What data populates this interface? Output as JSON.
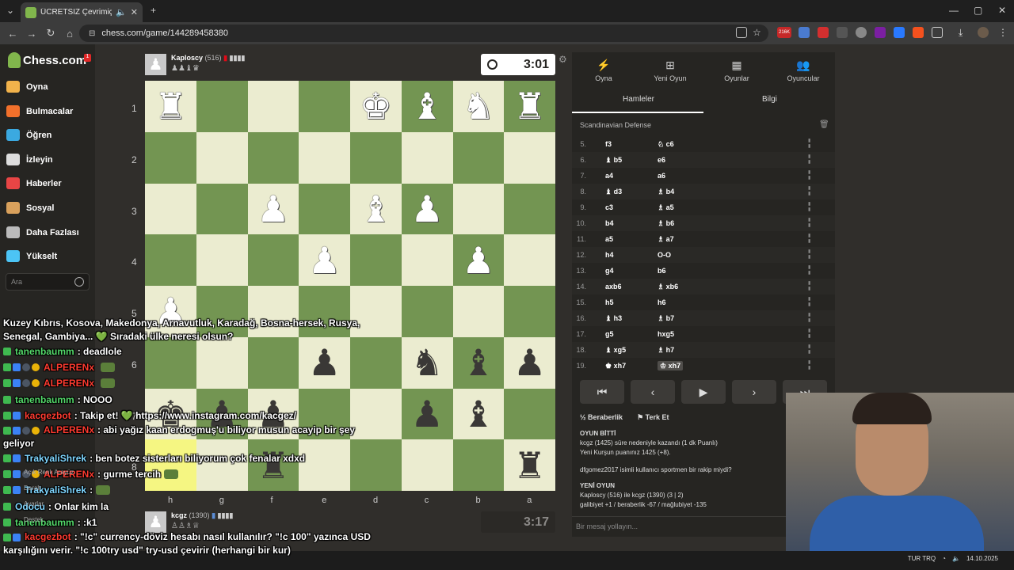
{
  "browser": {
    "tab_title": "ÜCRETSİZ Çevrimiçi Satranç",
    "url": "chess.com/game/144289458380",
    "ext_badge": "216K"
  },
  "sidebar": {
    "logo": "Chess.com",
    "notif_count": "1",
    "items": [
      {
        "label": "Oyna",
        "icon": "pawn-play-icon",
        "color": "#f2b34b"
      },
      {
        "label": "Bulmacalar",
        "icon": "puzzle-icon",
        "color": "#f2702b"
      },
      {
        "label": "Öğren",
        "icon": "learn-icon",
        "color": "#3ba9e0"
      },
      {
        "label": "İzleyin",
        "icon": "binoculars-icon",
        "color": "#dddddd"
      },
      {
        "label": "Haberler",
        "icon": "news-icon",
        "color": "#e84545"
      },
      {
        "label": "Sosyal",
        "icon": "social-icon",
        "color": "#d9a15c"
      },
      {
        "label": "Daha Fazlası",
        "icon": "more-icon",
        "color": "#bbbbbb"
      },
      {
        "label": "Yükselt",
        "icon": "diamond-icon",
        "color": "#4cc4f5"
      }
    ],
    "search_placeholder": "Ara"
  },
  "game": {
    "top_player": {
      "name": "Kaploscy",
      "rating": "(516)",
      "clock": "3:01"
    },
    "bottom_player": {
      "name": "kcgz",
      "rating": "(1390)",
      "clock": "3:17"
    },
    "ranks": [
      "1",
      "2",
      "3",
      "4",
      "5",
      "6",
      "7",
      "8"
    ],
    "files": [
      "h",
      "g",
      "f",
      "e",
      "d",
      "c",
      "b",
      "a"
    ],
    "board": [
      [
        "wR",
        "",
        "",
        "",
        "wK",
        "wB",
        "wN",
        "wR"
      ],
      [
        "",
        "",
        "",
        "",
        "",
        "",
        "",
        ""
      ],
      [
        "",
        "",
        "wP",
        "",
        "wB",
        "wP",
        "",
        ""
      ],
      [
        "",
        "",
        "",
        "wP",
        "",
        "",
        "wP",
        ""
      ],
      [
        "wP",
        "",
        "",
        "",
        "",
        "",
        "",
        ""
      ],
      [
        "",
        "",
        "",
        "bP",
        "",
        "bN",
        "bB",
        "bP"
      ],
      [
        "bK",
        "bP",
        "bP",
        "",
        "",
        "bP",
        "bB",
        ""
      ],
      [
        "",
        "",
        "bR",
        "",
        "",
        "",
        "",
        "bR"
      ]
    ],
    "highlights": [
      "7-0",
      "8-1"
    ]
  },
  "panel": {
    "tabs": [
      "Oyna",
      "Yeni Oyun",
      "Oyunlar",
      "Oyuncular"
    ],
    "subtabs": [
      "Hamleler",
      "Bilgi"
    ],
    "opening": "Scandinavian Defense",
    "moves": [
      {
        "n": "5.",
        "w": "f3",
        "b": "♘ c6"
      },
      {
        "n": "6.",
        "w": "♝ b5",
        "b": "e6"
      },
      {
        "n": "7.",
        "w": "a4",
        "b": "a6"
      },
      {
        "n": "8.",
        "w": "♝ d3",
        "b": "♗ b4"
      },
      {
        "n": "9.",
        "w": "c3",
        "b": "♗ a5"
      },
      {
        "n": "10.",
        "w": "b4",
        "b": "♗ b6"
      },
      {
        "n": "11.",
        "w": "a5",
        "b": "♗ a7"
      },
      {
        "n": "12.",
        "w": "h4",
        "b": "O-O"
      },
      {
        "n": "13.",
        "w": "g4",
        "b": "b6"
      },
      {
        "n": "14.",
        "w": "axb6",
        "b": "♗ xb6"
      },
      {
        "n": "15.",
        "w": "h5",
        "b": "h6"
      },
      {
        "n": "16.",
        "w": "♝ h3",
        "b": "♗ b7"
      },
      {
        "n": "17.",
        "w": "g5",
        "b": "hxg5"
      },
      {
        "n": "18.",
        "w": "♝ xg5",
        "b": "♗ h7"
      },
      {
        "n": "19.",
        "w": "♚ xh7",
        "b": "♔ xh7"
      }
    ],
    "draw_label": "Beraberlik",
    "resign_label": "Terk Et",
    "result_title": "OYUN BİTTİ",
    "result_line1": "kcgz (1425) süre nedeniyle kazandı (1 dk Puanlı)",
    "result_line2": "Yeni Kurşun puanınız 1425 (+8).",
    "question": "dfgomez2017 isimli kullanıcı sportmen bir rakip miydi?",
    "new_game_title": "YENİ OYUN",
    "new_game_line1": "Kaploscy (516) ile kcgz (1390) (3 | 2)",
    "new_game_line2": "galibiyet +1 / beraberlik -67 / mağlubiyet -135",
    "message_placeholder": "Bir mesaj yollayın..."
  },
  "chat": {
    "intro": "Kuzey Kıbrıs, Kosova, Makedonya, Arnavutluk, Karadağ, Bosna-hersek, Rusya, Senegal, Gambiya... 💚 Sıradaki ülke neresi olsun?",
    "lines": [
      {
        "user": "tanenbaumm",
        "color": "u-green",
        "text": ": deadlole",
        "badges": [
          "b-green"
        ]
      },
      {
        "user": "ALPERENx",
        "color": "u-red",
        "text": "",
        "badges": [
          "b-green",
          "b-blue",
          "b-dark",
          "b-gold"
        ],
        "emote": true
      },
      {
        "user": "ALPERENx",
        "color": "u-red",
        "text": "",
        "badges": [
          "b-green",
          "b-blue",
          "b-dark",
          "b-gold"
        ],
        "emote": true
      },
      {
        "user": "tanenbaumm",
        "color": "u-green",
        "text": ": NOOO",
        "badges": [
          "b-green"
        ]
      },
      {
        "user": "kacgezbot",
        "color": "u-red",
        "text": ": Takip et! 💚 https://www.instagram.com/kacgez/",
        "badges": [
          "b-green",
          "b-blue"
        ]
      },
      {
        "user": "ALPERENx",
        "color": "u-red",
        "text": ": abi yağız kaan erdogmuş'u biliyor musun acayip bir şey geliyor",
        "badges": [
          "b-green",
          "b-blue",
          "b-dark",
          "b-gold"
        ],
        "wrap": true
      },
      {
        "user": "TrakyaliShrek",
        "color": "u-cyan",
        "text": ": ben botez sisterları biliyorum çok fenalar xdxd",
        "badges": [
          "b-green",
          "b-blue"
        ]
      },
      {
        "user": "ALPERENx",
        "color": "u-red",
        "text": ": gurme tercih",
        "badges": [
          "b-green",
          "b-blue",
          "b-dark",
          "b-gold"
        ],
        "emote": true
      },
      {
        "user": "TrakyaliShrek",
        "color": "u-cyan",
        "text": ":",
        "badges": [
          "b-green",
          "b-blue"
        ],
        "emote": true
      },
      {
        "user": "Odocu",
        "color": "u-cyan",
        "text": ": Onlar kim la",
        "badges": [
          "b-green"
        ]
      },
      {
        "user": "tanenbaumm",
        "color": "u-green",
        "text": ": :k1",
        "badges": [
          "b-green"
        ]
      },
      {
        "user": "kacgezbot",
        "color": "u-red",
        "text": ": \"!c\" currency-döviz hesabı nasıl kullanılır? \"!c 100\" yazınca USD karşılığını verir. \"!c 100try usd\" try-usd çevirir (herhangi bir kur)",
        "badges": [
          "b-green",
          "b-blue"
        ],
        "wrap": true
      }
    ],
    "ghost_items": [
      "Açık Renk Arayüz",
      "Daralt",
      "Ayarlar",
      "Destek"
    ]
  },
  "taskbar": {
    "lang": "TUR TRQ",
    "date": "14.10.2025"
  }
}
